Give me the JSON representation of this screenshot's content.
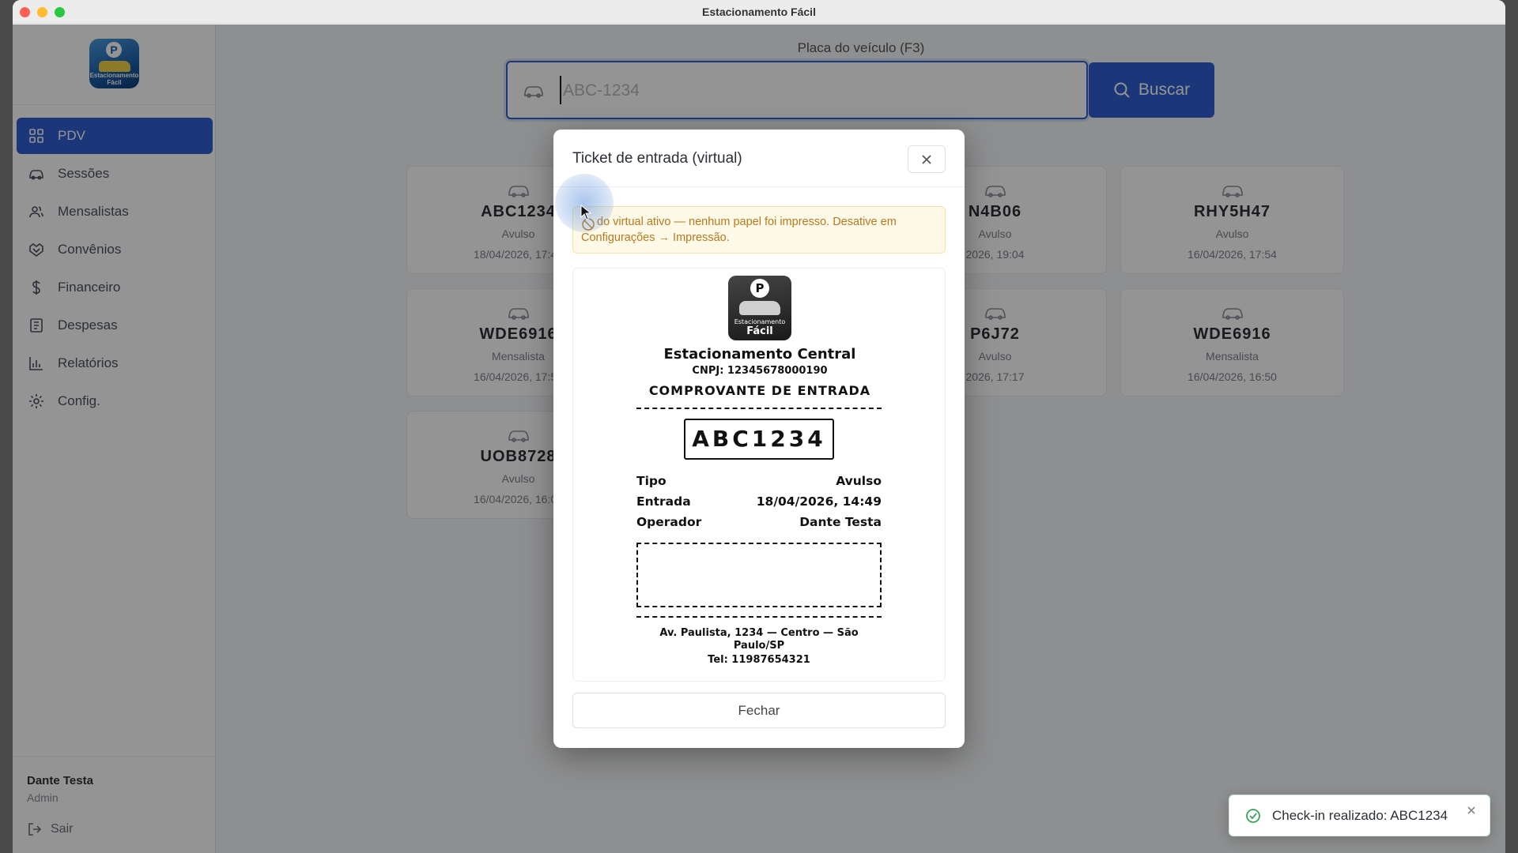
{
  "window": {
    "title": "Estacionamento Fácil"
  },
  "sidebar": {
    "logo_text": "Estacionamento Fácil",
    "items": [
      {
        "label": "PDV",
        "icon": "grid-icon",
        "active": true
      },
      {
        "label": "Sessões",
        "icon": "car-icon",
        "active": false
      },
      {
        "label": "Mensalistas",
        "icon": "users-icon",
        "active": false
      },
      {
        "label": "Convênios",
        "icon": "handshake-icon",
        "active": false
      },
      {
        "label": "Financeiro",
        "icon": "dollar-icon",
        "active": false
      },
      {
        "label": "Despesas",
        "icon": "receipt-icon",
        "active": false
      },
      {
        "label": "Relatórios",
        "icon": "chart-icon",
        "active": false
      },
      {
        "label": "Config.",
        "icon": "gear-icon",
        "active": false
      }
    ],
    "user": {
      "name": "Dante Testa",
      "role": "Admin"
    },
    "logout_label": "Sair"
  },
  "search": {
    "label": "Placa do veículo (F3)",
    "placeholder": "ABC-1234",
    "value": "",
    "button_label": "Buscar"
  },
  "cards": [
    {
      "plate": "ABC1234",
      "type": "Avulso",
      "time": "18/04/2026, 17:45"
    },
    {
      "plate": "N4B06",
      "type": "Avulso",
      "time": "2026, 19:04"
    },
    {
      "plate": "RHY5H47",
      "type": "Avulso",
      "time": "16/04/2026, 17:54"
    },
    {
      "plate": "WDE6916",
      "type": "Mensalista",
      "time": "16/04/2026, 17:54"
    },
    {
      "plate": "P6J72",
      "type": "Avulso",
      "time": "2026, 17:17"
    },
    {
      "plate": "WDE6916",
      "type": "Mensalista",
      "time": "16/04/2026, 16:50"
    },
    {
      "plate": "UOB8728",
      "type": "Avulso",
      "time": "16/04/2026, 16:01"
    }
  ],
  "modal": {
    "title": "Ticket de entrada (virtual)",
    "warning": "do virtual ativo — nenhum papel foi impresso. Desative em Configurações → Impressão.",
    "receipt": {
      "logo_line1": "Estacionamento",
      "logo_line2": "Fácil",
      "name": "Estacionamento Central",
      "cnpj": "CNPJ: 12345678000190",
      "heading": "COMPROVANTE DE ENTRADA",
      "plate": "ABC1234",
      "rows": [
        {
          "label": "Tipo",
          "value": "Avulso"
        },
        {
          "label": "Entrada",
          "value": "18/04/2026, 14:49"
        },
        {
          "label": "Operador",
          "value": "Dante Testa"
        }
      ],
      "address": "Av. Paulista, 1234 — Centro — São Paulo/SP",
      "tel": "Tel: 11987654321"
    },
    "close_label": "Fechar"
  },
  "toast": {
    "message": "Check-in realizado: ABC1234"
  },
  "colors": {
    "accent": "#2f5fd0",
    "warning_bg": "#fff9e8",
    "warning_text": "#b7791f",
    "success": "#3aa35a"
  }
}
